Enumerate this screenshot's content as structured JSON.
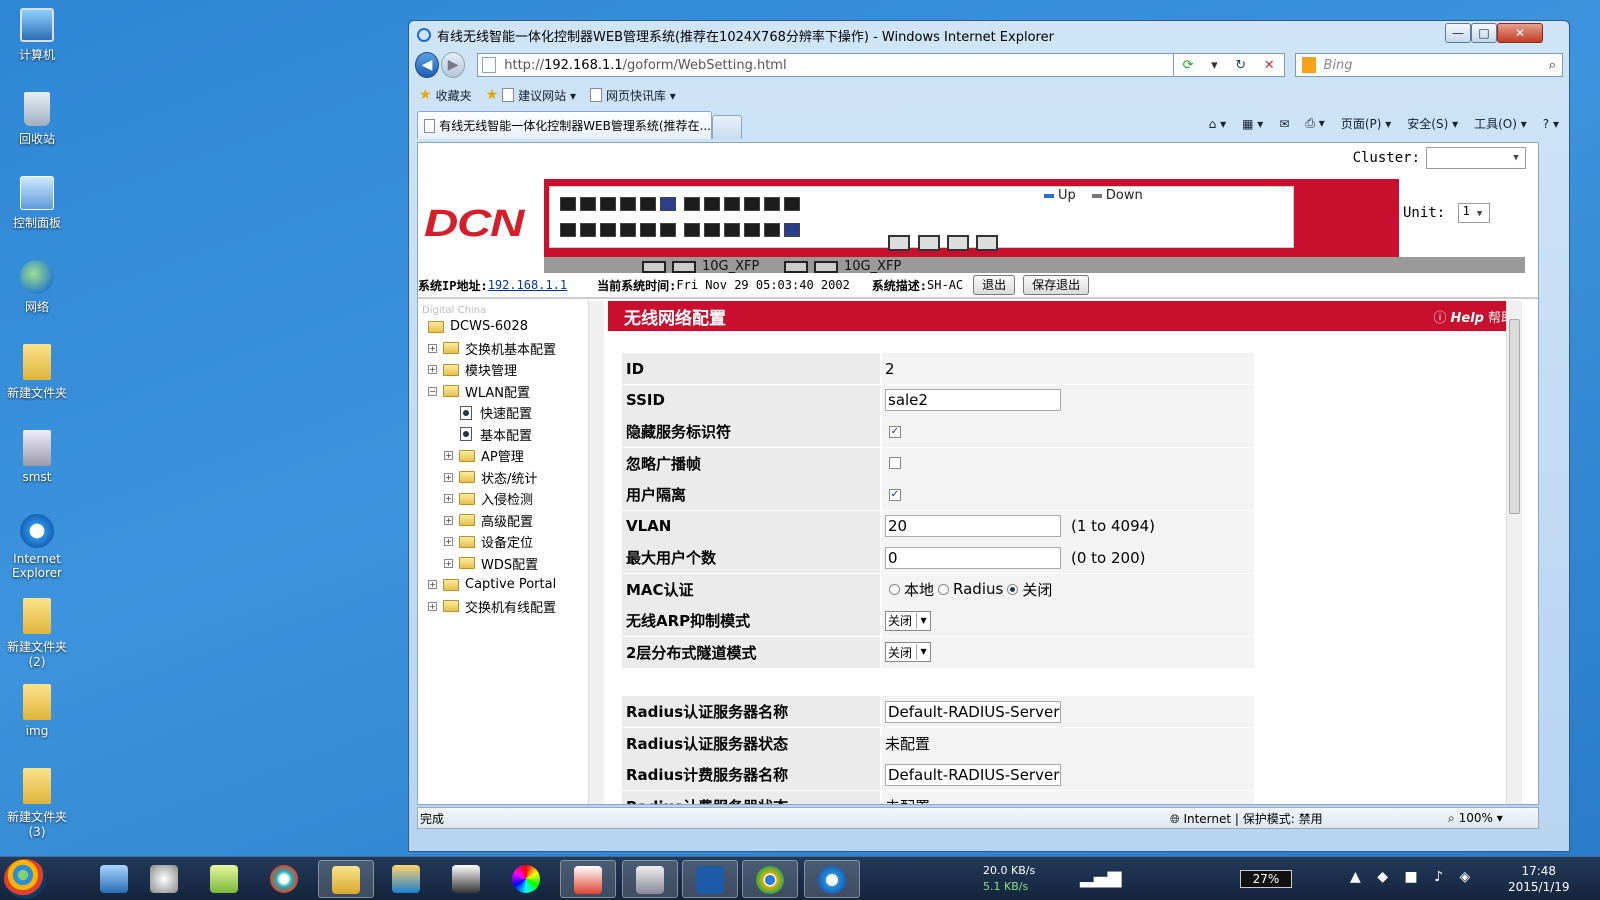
{
  "desktop": {
    "icons": [
      {
        "label": "计算机",
        "icon": "computer-icon"
      },
      {
        "label": "回收站",
        "icon": "recycle-bin-icon"
      },
      {
        "label": "控制面板",
        "icon": "control-panel-icon"
      },
      {
        "label": "网络",
        "icon": "network-icon"
      },
      {
        "label": "新建文件夹",
        "icon": "folder-icon"
      },
      {
        "label": "smst",
        "icon": "file-icon"
      },
      {
        "label": "Internet Explorer",
        "icon": "ie-icon"
      },
      {
        "label": "新建文件夹 (2)",
        "icon": "folder-icon"
      },
      {
        "label": "img",
        "icon": "folder-icon"
      },
      {
        "label": "新建文件夹 (3)",
        "icon": "folder-icon"
      }
    ]
  },
  "window": {
    "title": "有线无线智能一体化控制器WEB管理系统(推荐在1024X768分辨率下操作) - Windows Internet Explorer",
    "min": "—",
    "max": "□",
    "close": "✕"
  },
  "address": {
    "prefix": "http://",
    "host": "192.168.1.1",
    "path": "/goform/WebSetting.html",
    "search_placeholder": "Bing"
  },
  "favorites": {
    "label": "收藏夹",
    "items": [
      "建议网站 ▾",
      "网页快讯库 ▾"
    ]
  },
  "tabs": {
    "active": "有线无线智能一体化控制器WEB管理系统(推荐在..."
  },
  "cmdbar": {
    "page": "页面(P) ▾",
    "safety": "安全(S) ▾",
    "tools": "工具(O) ▾",
    "help": "? ▾"
  },
  "device": {
    "cluster_label": "Cluster:",
    "logo": "DCN",
    "legend_up": "Up",
    "legend_down": "Down",
    "xfp1": "10G_XFP",
    "xfp2": "10G_XFP",
    "unit_label": "Unit:",
    "unit_value": "1",
    "colors": {
      "brand_red": "#c8102e",
      "port_up": "#2c3e8c",
      "port_down": "#1c1c1c"
    }
  },
  "sysinfo": {
    "ip_label": "系统IP地址:",
    "ip_value": "192.168.1.1",
    "time_label": "当前系统时间:",
    "time_value": "Fri Nov 29 05:03:40 2002",
    "desc_label": "系统描述:",
    "desc_value": "SH-AC",
    "logout": "退出",
    "save_logout": "保存退出"
  },
  "tree": {
    "header": "Digital China",
    "root": "DCWS-6028",
    "items": [
      {
        "label": "交换机基本配置",
        "level": 1,
        "type": "folder",
        "expander": "+"
      },
      {
        "label": "模块管理",
        "level": 1,
        "type": "folder",
        "expander": "+"
      },
      {
        "label": "WLAN配置",
        "level": 1,
        "type": "folder",
        "expander": "−"
      },
      {
        "label": "快速配置",
        "level": 2,
        "type": "doc"
      },
      {
        "label": "基本配置",
        "level": 2,
        "type": "doc"
      },
      {
        "label": "AP管理",
        "level": 2,
        "type": "folder",
        "expander": "+"
      },
      {
        "label": "状态/统计",
        "level": 2,
        "type": "folder",
        "expander": "+"
      },
      {
        "label": "入侵检测",
        "level": 2,
        "type": "folder",
        "expander": "+"
      },
      {
        "label": "高级配置",
        "level": 2,
        "type": "folder",
        "expander": "+"
      },
      {
        "label": "设备定位",
        "level": 2,
        "type": "folder",
        "expander": "+"
      },
      {
        "label": "WDS配置",
        "level": 2,
        "type": "folder",
        "expander": "+"
      },
      {
        "label": "Captive Portal",
        "level": 1,
        "type": "folder",
        "expander": "+"
      },
      {
        "label": "交换机有线配置",
        "level": 1,
        "type": "folder",
        "expander": "+"
      }
    ]
  },
  "content": {
    "title": "无线网络配置",
    "help_en": "Help",
    "help_cn": "帮助",
    "fields": {
      "id": {
        "label": "ID",
        "value": "2"
      },
      "ssid": {
        "label": "SSID",
        "value": "sale2"
      },
      "hide_ssid": {
        "label": "隐藏服务标识符",
        "checked": true
      },
      "ignore_broadcast": {
        "label": "忽略广播帧",
        "checked": false
      },
      "user_isolation": {
        "label": "用户隔离",
        "checked": true
      },
      "vlan": {
        "label": "VLAN",
        "value": "20",
        "hint": "(1 to 4094)"
      },
      "max_users": {
        "label": "最大用户个数",
        "value": "0",
        "hint": "(0 to 200)"
      },
      "mac_auth": {
        "label": "MAC认证",
        "options": [
          "本地",
          "Radius",
          "关闭"
        ],
        "selected": 2
      },
      "arp_mode": {
        "label": "无线ARP抑制模式",
        "value": "关闭"
      },
      "l2_tunnel": {
        "label": "2层分布式隧道模式",
        "value": "关闭"
      },
      "radius_auth_name": {
        "label": "Radius认证服务器名称",
        "value": "Default-RADIUS-Server"
      },
      "radius_auth_status": {
        "label": "Radius认证服务器状态",
        "value": "未配置"
      },
      "radius_acct_name": {
        "label": "Radius计费服务器名称",
        "value": "Default-RADIUS-Server"
      },
      "radius_acct_status": {
        "label": "Radius计费服务器状态",
        "value": "未配置"
      }
    }
  },
  "statusbar": {
    "text": "完成",
    "zone": "Internet | 保护模式: 禁用",
    "zoom": "100%"
  },
  "taskbar": {
    "net_down": "20.0 KB/s",
    "net_up": "5.1 KB/s",
    "battery": "27%",
    "time": "17:48",
    "date": "2015/1/19"
  }
}
